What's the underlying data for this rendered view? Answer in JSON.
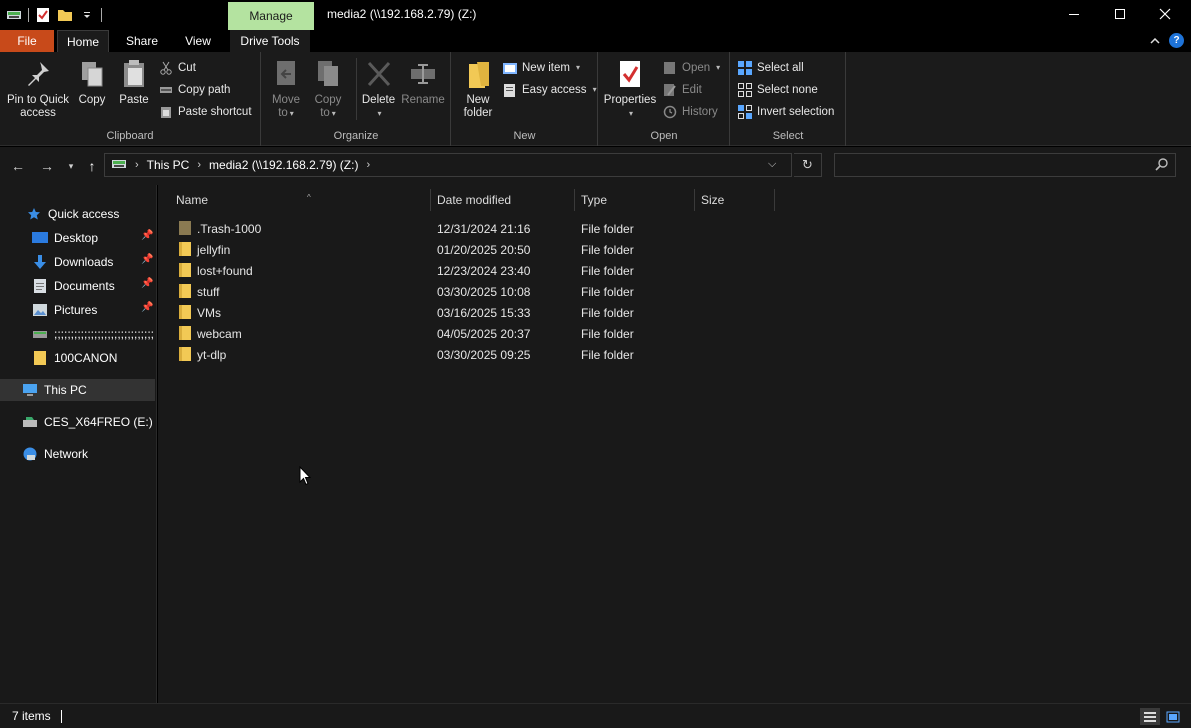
{
  "titlebar": {
    "manage_tab": "Manage",
    "title": "media2 (\\\\192.168.2.79) (Z:)",
    "quick_access_icons": [
      "drive-icon",
      "properties-icon",
      "new-folder-icon",
      "customize-dropdown-icon"
    ]
  },
  "tabs": {
    "file": "File",
    "home": "Home",
    "share": "Share",
    "view": "View",
    "drive_tools": "Drive Tools"
  },
  "ribbon": {
    "clipboard": {
      "label": "Clipboard",
      "pin_line1": "Pin to Quick",
      "pin_line2": "access",
      "copy": "Copy",
      "paste": "Paste",
      "cut": "Cut",
      "copy_path": "Copy path",
      "paste_shortcut": "Paste shortcut"
    },
    "organize": {
      "label": "Organize",
      "move_line1": "Move",
      "move_line2": "to",
      "copy_line1": "Copy",
      "copy_line2": "to",
      "delete": "Delete",
      "rename": "Rename"
    },
    "new": {
      "label": "New",
      "new_folder_line1": "New",
      "new_folder_line2": "folder",
      "new_item": "New item",
      "easy_access": "Easy access"
    },
    "open": {
      "label": "Open",
      "properties": "Properties",
      "open": "Open",
      "edit": "Edit",
      "history": "History"
    },
    "select": {
      "label": "Select",
      "select_all": "Select all",
      "select_none": "Select none",
      "invert_selection": "Invert selection"
    }
  },
  "address": {
    "crumbs": [
      "This PC",
      "media2 (\\\\192.168.2.79) (Z:)"
    ],
    "search_placeholder": ""
  },
  "nav": {
    "quick_access": "Quick access",
    "pinned": [
      {
        "label": "Desktop"
      },
      {
        "label": "Downloads"
      },
      {
        "label": "Documents"
      },
      {
        "label": "Pictures"
      }
    ],
    "recent_placeholder": ";;;;;;;;;;;;;;;;;;;;;;;;;;;;;;;;;;;;",
    "folder_100canon": "100CANON",
    "this_pc": "This PC",
    "drive_e": "CES_X64FREO (E:)",
    "network": "Network"
  },
  "columns": {
    "name": "Name",
    "date_modified": "Date modified",
    "type": "Type",
    "size": "Size"
  },
  "files": [
    {
      "name": ".Trash-1000",
      "date": "12/31/2024 21:16",
      "type": "File folder"
    },
    {
      "name": "jellyfin",
      "date": "01/20/2025 20:50",
      "type": "File folder"
    },
    {
      "name": "lost+found",
      "date": "12/23/2024 23:40",
      "type": "File folder"
    },
    {
      "name": "stuff",
      "date": "03/30/2025 10:08",
      "type": "File folder"
    },
    {
      "name": "VMs",
      "date": "03/16/2025 15:33",
      "type": "File folder"
    },
    {
      "name": "webcam",
      "date": "04/05/2025 20:37",
      "type": "File folder"
    },
    {
      "name": "yt-dlp",
      "date": "03/30/2025 09:25",
      "type": "File folder"
    }
  ],
  "status": {
    "item_count": "7 items"
  },
  "colors": {
    "file_tab": "#c84a1a",
    "manage_tab": "#b4e3a0",
    "folder": "#f2c955",
    "trash_folder": "#8a7a52",
    "background": "#191919"
  }
}
